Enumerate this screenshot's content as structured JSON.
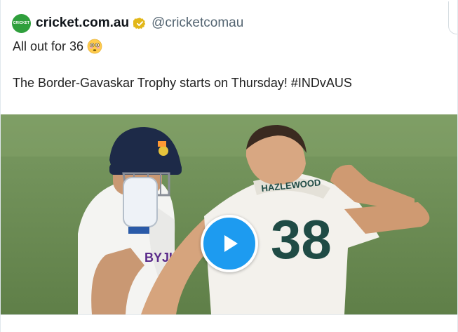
{
  "tweet": {
    "author_name": "cricket.com.au",
    "author_handle": "@cricketcomau",
    "avatar_text": "CRICKET",
    "verified": true,
    "line1": "All out for 36",
    "line1_emoji": "flushed-face-emoji",
    "line2": "The Border-Gavaskar Trophy starts on Thursday! #INDvAUS"
  },
  "media": {
    "type": "video",
    "play_icon": "play-icon",
    "jersey_name": "HAZLEWOOD",
    "jersey_number": "38",
    "shirt_sponsor": "BYJU'S",
    "colors": {
      "play_button": "#1d9bf0",
      "field": "#6f8e57",
      "avatar": "#2f9f3c",
      "verified": "#e2b719"
    }
  }
}
